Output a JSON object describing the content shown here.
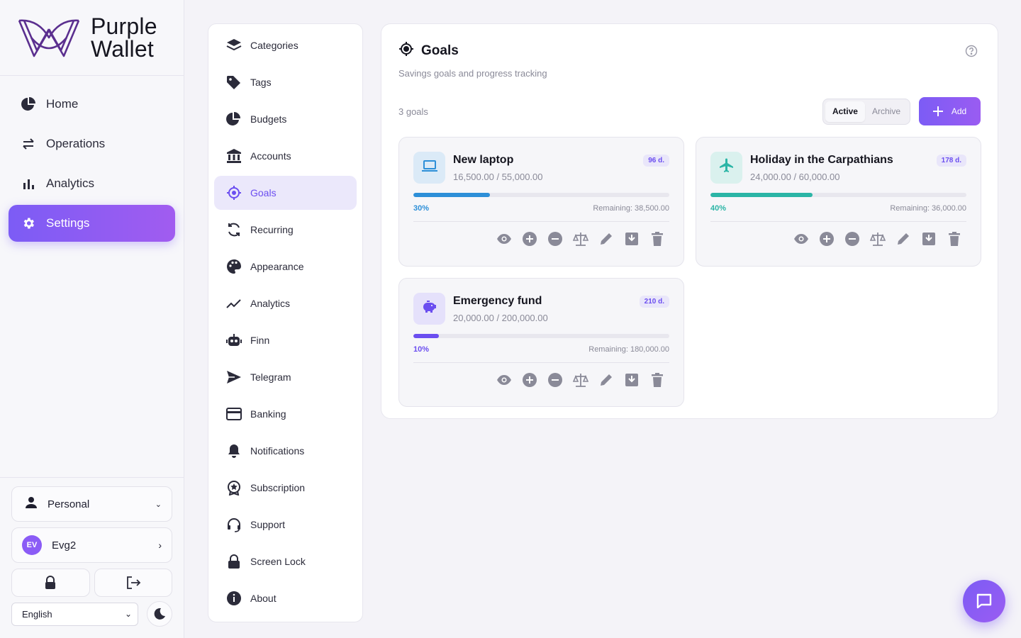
{
  "brand": {
    "line1": "Purple",
    "line2": "Wallet"
  },
  "nav": [
    {
      "label": "Home",
      "icon": "pie-icon"
    },
    {
      "label": "Operations",
      "icon": "swap-icon"
    },
    {
      "label": "Analytics",
      "icon": "bar-chart-icon"
    },
    {
      "label": "Settings",
      "icon": "gear-icon",
      "active": true
    }
  ],
  "profile": {
    "label": "Personal"
  },
  "user": {
    "initials": "EV",
    "name": "Evg2"
  },
  "language": {
    "selected": "English"
  },
  "settings_menu": [
    {
      "label": "Categories",
      "icon": "layers-icon"
    },
    {
      "label": "Tags",
      "icon": "tag-icon"
    },
    {
      "label": "Budgets",
      "icon": "pie-icon"
    },
    {
      "label": "Accounts",
      "icon": "bank-icon"
    },
    {
      "label": "Goals",
      "icon": "target-icon",
      "active": true
    },
    {
      "label": "Recurring",
      "icon": "refresh-icon"
    },
    {
      "label": "Appearance",
      "icon": "palette-icon"
    },
    {
      "label": "Analytics",
      "icon": "trend-icon"
    },
    {
      "label": "Finn",
      "icon": "robot-icon"
    },
    {
      "label": "Telegram",
      "icon": "send-icon"
    },
    {
      "label": "Banking",
      "icon": "card-icon"
    },
    {
      "label": "Notifications",
      "icon": "bell-icon"
    },
    {
      "label": "Subscription",
      "icon": "badge-icon"
    },
    {
      "label": "Support",
      "icon": "headset-icon"
    },
    {
      "label": "Screen Lock",
      "icon": "lock-icon"
    },
    {
      "label": "About",
      "icon": "info-icon"
    }
  ],
  "goals": {
    "title": "Goals",
    "subtitle": "Savings goals and progress tracking",
    "count": "3 goals",
    "tabs": {
      "active": "Active",
      "archive": "Archive"
    },
    "add_label": "Add",
    "items": [
      {
        "name": "New laptop",
        "amount": "16,500.00 / 55,000.00",
        "days": "96 d.",
        "percent_label": "30%",
        "progress": 0.3,
        "remaining": "Remaining: 38,500.00",
        "icon": "laptop-icon",
        "color": "#2d8fd8",
        "icon_bg": "#dbeaf7"
      },
      {
        "name": "Holiday in the Carpathians",
        "amount": "24,000.00 / 60,000.00",
        "days": "178 d.",
        "percent_label": "40%",
        "progress": 0.4,
        "remaining": "Remaining: 36,000.00",
        "icon": "plane-icon",
        "color": "#2bb5a6",
        "icon_bg": "#daf1ee"
      },
      {
        "name": "Emergency fund",
        "amount": "20,000.00 / 200,000.00",
        "days": "210 d.",
        "percent_label": "10%",
        "progress": 0.1,
        "remaining": "Remaining: 180,000.00",
        "icon": "piggy-bank-icon",
        "color": "#6b4ef0",
        "icon_bg": "#e5e1fb"
      }
    ]
  },
  "colors": {
    "accent": "#7c5cf5",
    "days_badge_bg": "#e9e6fa",
    "days_badge_text": "#6b4ef0"
  }
}
